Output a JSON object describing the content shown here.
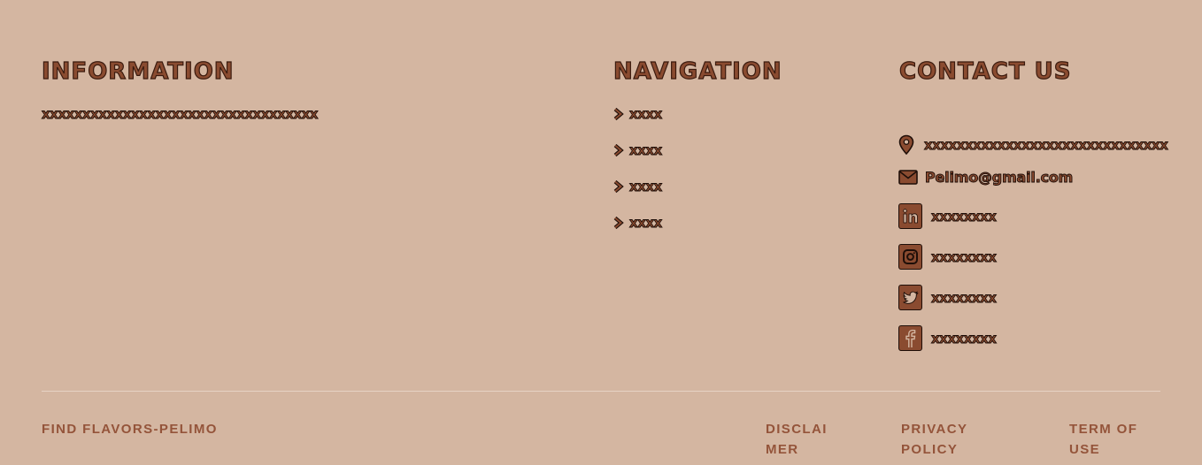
{
  "information": {
    "heading": "INFORMATION",
    "text": "xxxxxxxxxxxxxxxxxxxxxxxxxxxxxxxxxx"
  },
  "navigation": {
    "heading": "NAVIGATION",
    "items": [
      {
        "label": "xxxx"
      },
      {
        "label": "xxxx"
      },
      {
        "label": "xxxx"
      },
      {
        "label": "xxxx"
      }
    ]
  },
  "contact": {
    "heading": "CONTACT US",
    "address": "xxxxxxxxxxxxxxxxxxxxxxxxxxxxxx",
    "email": "Pelimo@gmail.com",
    "socials": [
      {
        "icon": "linkedin-icon",
        "label": "xxxxxxxx"
      },
      {
        "icon": "instagram-icon",
        "label": "xxxxxxxx"
      },
      {
        "icon": "twitter-icon",
        "label": "xxxxxxxx"
      },
      {
        "icon": "facebook-icon",
        "label": "xxxxxxxx"
      }
    ]
  },
  "footer": {
    "brand": "FIND FLAVORS-PELIMO",
    "disclaimer_line1": "DISCLAI",
    "disclaimer_line2": "MER",
    "privacy_line1": "PRIVACY",
    "privacy_line2": "POLICY",
    "terms_line1": "TERM OF",
    "terms_line2": "USE"
  },
  "colors": {
    "background": "#d4b6a1",
    "accent": "#8a4b30",
    "outline": "#1e0e08",
    "footer_link": "#94543a"
  }
}
